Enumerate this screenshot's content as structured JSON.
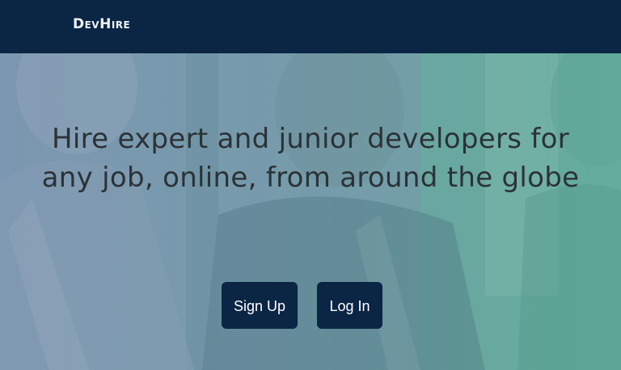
{
  "nav": {
    "brand": "DevHire"
  },
  "hero": {
    "headline": "Hire expert and junior developers for any job, online, from around the globe",
    "signup_label": "Sign Up",
    "login_label": "Log In"
  },
  "colors": {
    "navbar": "#0b2545",
    "button": "#0b2545",
    "headline_text": "#2b3236",
    "hero_tint": "#6fa6a6"
  }
}
